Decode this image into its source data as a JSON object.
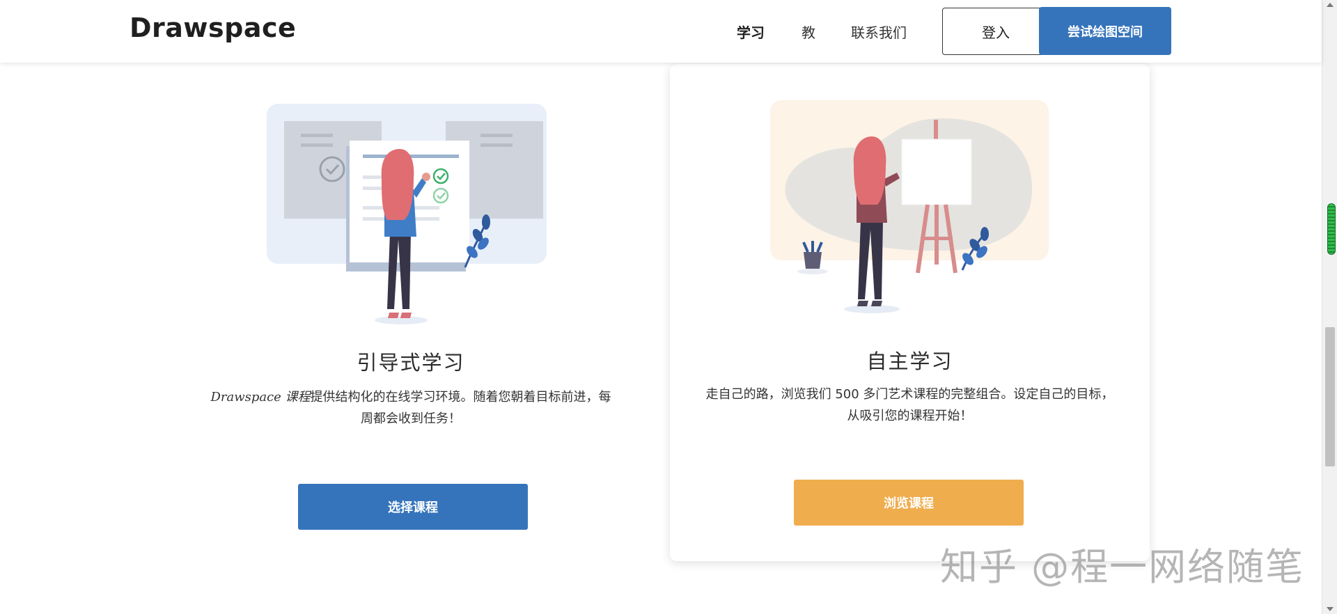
{
  "header": {
    "logo": "Drawspace",
    "nav": [
      {
        "label": "学习",
        "active": true
      },
      {
        "label": "教",
        "active": false
      },
      {
        "label": "联系我们",
        "active": false
      }
    ],
    "login_label": "登入",
    "try_label": "尝试绘图空间"
  },
  "cards": [
    {
      "title": "引导式学习",
      "desc_brand": "Drawspace 课程",
      "desc_rest": "提供结构化的在线学习环境。随着您朝着目标前进，每周都会收到任务！",
      "button_label": "选择课程",
      "button_color": "#3574bb"
    },
    {
      "title": "自主学习",
      "desc": "走自己的路，浏览我们 500 多门艺术课程的完整组合。设定自己的目标，从吸引您的课程开始！",
      "button_label": "浏览课程",
      "button_color": "#f0ad4e"
    }
  ],
  "watermark": "知乎 @程一网络随笔",
  "colors": {
    "accent": "#3574bb",
    "secondary": "#f0ad4e"
  }
}
